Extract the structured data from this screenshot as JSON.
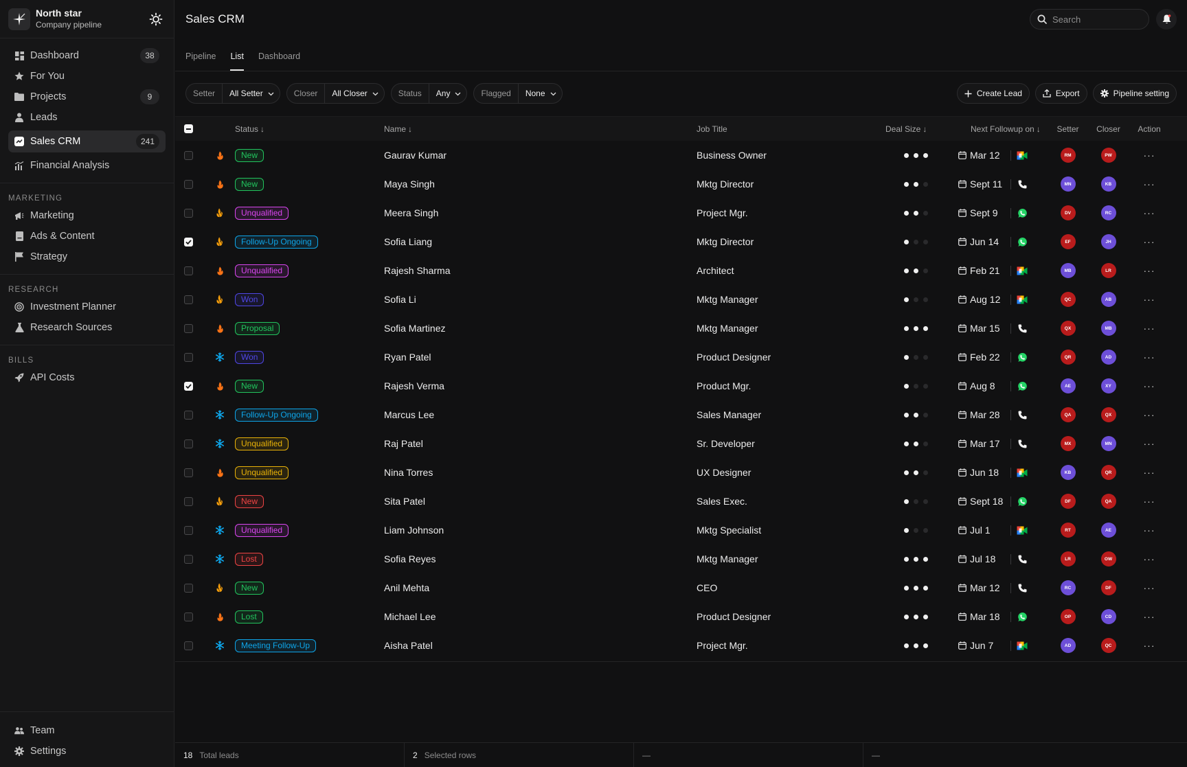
{
  "brand": {
    "title": "North star",
    "subtitle": "Company pipeline"
  },
  "nav": {
    "main": [
      {
        "label": "Dashboard",
        "count": "38",
        "icon": "grid-icon"
      },
      {
        "label": "For You",
        "count": "",
        "icon": "star-icon"
      },
      {
        "label": "Projects",
        "count": "9",
        "icon": "folder-icon"
      },
      {
        "label": "Leads",
        "count": "",
        "icon": "person-icon"
      },
      {
        "label": "Sales CRM",
        "count": "241",
        "icon": "chart-square-icon",
        "active": true
      },
      {
        "label": "Financial Analysis",
        "count": "",
        "icon": "bar-chart-icon"
      }
    ],
    "marketing_label": "MARKETING",
    "marketing": [
      {
        "label": "Marketing",
        "icon": "megaphone-icon"
      },
      {
        "label": "Ads & Content",
        "icon": "document-icon"
      },
      {
        "label": "Strategy",
        "icon": "flag-icon"
      }
    ],
    "research_label": "RESEARCH",
    "research": [
      {
        "label": "Investment Planner",
        "icon": "target-icon"
      },
      {
        "label": "Research Sources",
        "icon": "flask-icon"
      }
    ],
    "bills_label": "BILLS",
    "bills": [
      {
        "label": "API Costs",
        "icon": "rocket-icon"
      }
    ],
    "bottom": [
      {
        "label": "Team",
        "icon": "team-icon"
      },
      {
        "label": "Settings",
        "icon": "gear-icon"
      }
    ]
  },
  "header": {
    "title": "Sales CRM",
    "search_placeholder": "Search"
  },
  "tabs": [
    "Pipeline",
    "List",
    "Dashboard"
  ],
  "filters": [
    {
      "label": "Setter",
      "value": "All Setter"
    },
    {
      "label": "Closer",
      "value": "All Closer"
    },
    {
      "label": "Status",
      "value": "Any"
    },
    {
      "label": "Flagged",
      "value": "None"
    }
  ],
  "actions": {
    "create": "Create Lead",
    "export": "Export",
    "pipeline": "Pipeline setting"
  },
  "columns": {
    "status": "Status",
    "name": "Name",
    "job": "Job Title",
    "deal": "Deal Size",
    "next": "Next Followup on",
    "setter": "Setter",
    "closer": "Closer",
    "action": "Action"
  },
  "colors": {
    "New": "#22c55e",
    "Unqualified": "#d946ef",
    "Follow-Up Ongoing": "#0ea5e9",
    "Won": "#4f46e5",
    "Proposal": "#22c55e",
    "Lost": "#ef4444",
    "Meeting Follow-Up": "#0ea5e9",
    "hot": "#f97316",
    "warm": "#f59e0b",
    "cold": "#0ea5e9",
    "setter_avatar_red": "#b91c1c",
    "avatar_purple": "#6d4fd8"
  },
  "rows": [
    {
      "checked": false,
      "temp": "hot",
      "status": "New",
      "statusColor": "#22c55e",
      "name": "Gaurav Kumar",
      "job": "Business Owner",
      "deal": 3,
      "date": "Mar 12",
      "channel": "meet",
      "setter": "RM",
      "setterColor": "#b91c1c",
      "closer": "PW",
      "closerColor": "#b91c1c"
    },
    {
      "checked": false,
      "temp": "hot",
      "status": "New",
      "statusColor": "#22c55e",
      "name": "Maya Singh",
      "job": "Mktg Director",
      "deal": 2,
      "date": "Sept 11",
      "channel": "phone",
      "setter": "MN",
      "setterColor": "#6d4fd8",
      "closer": "KB",
      "closerColor": "#6d4fd8"
    },
    {
      "checked": false,
      "temp": "warm",
      "status": "Unqualified",
      "statusColor": "#d946ef",
      "name": "Meera Singh",
      "job": "Project Mgr.",
      "deal": 2,
      "date": "Sept 9",
      "channel": "whatsapp",
      "setter": "DV",
      "setterColor": "#b91c1c",
      "closer": "RC",
      "closerColor": "#6d4fd8"
    },
    {
      "checked": true,
      "temp": "warm",
      "status": "Follow-Up Ongoing",
      "statusColor": "#0ea5e9",
      "name": "Sofia Liang",
      "job": "Mktg Director",
      "deal": 1,
      "date": "Jun 14",
      "channel": "whatsapp",
      "setter": "EF",
      "setterColor": "#b91c1c",
      "closer": "JH",
      "closerColor": "#6d4fd8"
    },
    {
      "checked": false,
      "temp": "hot",
      "status": "Unqualified",
      "statusColor": "#d946ef",
      "name": "Rajesh Sharma",
      "job": "Architect",
      "deal": 2,
      "date": "Feb 21",
      "channel": "meet",
      "setter": "MB",
      "setterColor": "#6d4fd8",
      "closer": "LR",
      "closerColor": "#b91c1c"
    },
    {
      "checked": false,
      "temp": "warm",
      "status": "Won",
      "statusColor": "#4f46e5",
      "name": "Sofia Li",
      "job": "Mktg Manager",
      "deal": 1,
      "date": "Aug 12",
      "channel": "meet",
      "setter": "QC",
      "setterColor": "#b91c1c",
      "closer": "AB",
      "closerColor": "#6d4fd8"
    },
    {
      "checked": false,
      "temp": "hot",
      "status": "Proposal",
      "statusColor": "#22c55e",
      "name": "Sofia Martinez",
      "job": "Mktg Manager",
      "deal": 3,
      "date": "Mar 15",
      "channel": "phone",
      "setter": "QX",
      "setterColor": "#b91c1c",
      "closer": "MB",
      "closerColor": "#6d4fd8"
    },
    {
      "checked": false,
      "temp": "cold",
      "status": "Won",
      "statusColor": "#4f46e5",
      "name": "Ryan Patel",
      "job": "Product Designer",
      "deal": 1,
      "date": "Feb 22",
      "channel": "whatsapp",
      "setter": "QR",
      "setterColor": "#b91c1c",
      "closer": "AD",
      "closerColor": "#6d4fd8"
    },
    {
      "checked": true,
      "temp": "hot",
      "status": "New",
      "statusColor": "#22c55e",
      "name": "Rajesh Verma",
      "job": "Product Mgr.",
      "deal": 1,
      "date": "Aug 8",
      "channel": "whatsapp",
      "setter": "AE",
      "setterColor": "#6d4fd8",
      "closer": "XY",
      "closerColor": "#6d4fd8"
    },
    {
      "checked": false,
      "temp": "cold",
      "status": "Follow-Up Ongoing",
      "statusColor": "#0ea5e9",
      "name": "Marcus Lee",
      "job": "Sales Manager",
      "deal": 2,
      "date": "Mar 28",
      "channel": "phone",
      "setter": "QA",
      "setterColor": "#b91c1c",
      "closer": "QX",
      "closerColor": "#b91c1c"
    },
    {
      "checked": false,
      "temp": "cold",
      "status": "Unqualified",
      "statusColor": "#eab308",
      "name": "Raj Patel",
      "job": "Sr. Developer",
      "deal": 2,
      "date": "Mar 17",
      "channel": "phone",
      "setter": "MX",
      "setterColor": "#b91c1c",
      "closer": "MN",
      "closerColor": "#6d4fd8"
    },
    {
      "checked": false,
      "temp": "hot",
      "status": "Unqualified",
      "statusColor": "#eab308",
      "name": "Nina Torres",
      "job": "UX Designer",
      "deal": 2,
      "date": "Jun 18",
      "channel": "meet",
      "setter": "KB",
      "setterColor": "#6d4fd8",
      "closer": "QR",
      "closerColor": "#b91c1c"
    },
    {
      "checked": false,
      "temp": "warm",
      "status": "New",
      "statusColor": "#ef4444",
      "name": "Sita Patel",
      "job": "Sales Exec.",
      "deal": 1,
      "date": "Sept 18",
      "channel": "whatsapp",
      "setter": "DF",
      "setterColor": "#b91c1c",
      "closer": "QA",
      "closerColor": "#b91c1c"
    },
    {
      "checked": false,
      "temp": "cold",
      "status": "Unqualified",
      "statusColor": "#d946ef",
      "name": "Liam Johnson",
      "job": "Mktg Specialist",
      "deal": 1,
      "date": "Jul 1",
      "channel": "meet",
      "setter": "RT",
      "setterColor": "#b91c1c",
      "closer": "AE",
      "closerColor": "#6d4fd8"
    },
    {
      "checked": false,
      "temp": "cold",
      "status": "Lost",
      "statusColor": "#ef4444",
      "name": "Sofia Reyes",
      "job": "Mktg Manager",
      "deal": 3,
      "date": "Jul 18",
      "channel": "phone",
      "setter": "LR",
      "setterColor": "#b91c1c",
      "closer": "OW",
      "closerColor": "#b91c1c"
    },
    {
      "checked": false,
      "temp": "warm",
      "status": "New",
      "statusColor": "#22c55e",
      "name": "Anil Mehta",
      "job": "CEO",
      "deal": 3,
      "date": "Mar 12",
      "channel": "phone",
      "setter": "RC",
      "setterColor": "#6d4fd8",
      "closer": "DF",
      "closerColor": "#b91c1c"
    },
    {
      "checked": false,
      "temp": "hot",
      "status": "Lost",
      "statusColor": "#22c55e",
      "name": "Michael Lee",
      "job": "Product Designer",
      "deal": 3,
      "date": "Mar 18",
      "channel": "whatsapp",
      "setter": "OP",
      "setterColor": "#b91c1c",
      "closer": "CD",
      "closerColor": "#6d4fd8"
    },
    {
      "checked": false,
      "temp": "cold",
      "status": "Meeting Follow-Up",
      "statusColor": "#0ea5e9",
      "name": "Aisha Patel",
      "job": "Project Mgr.",
      "deal": 3,
      "date": "Jun 7",
      "channel": "meet",
      "setter": "AD",
      "setterColor": "#6d4fd8",
      "closer": "QC",
      "closerColor": "#b91c1c"
    }
  ],
  "footer": {
    "total": "18",
    "total_label": "Total leads",
    "selected": "2",
    "selected_label": "Selected rows",
    "c3": "—",
    "c4": "—"
  }
}
